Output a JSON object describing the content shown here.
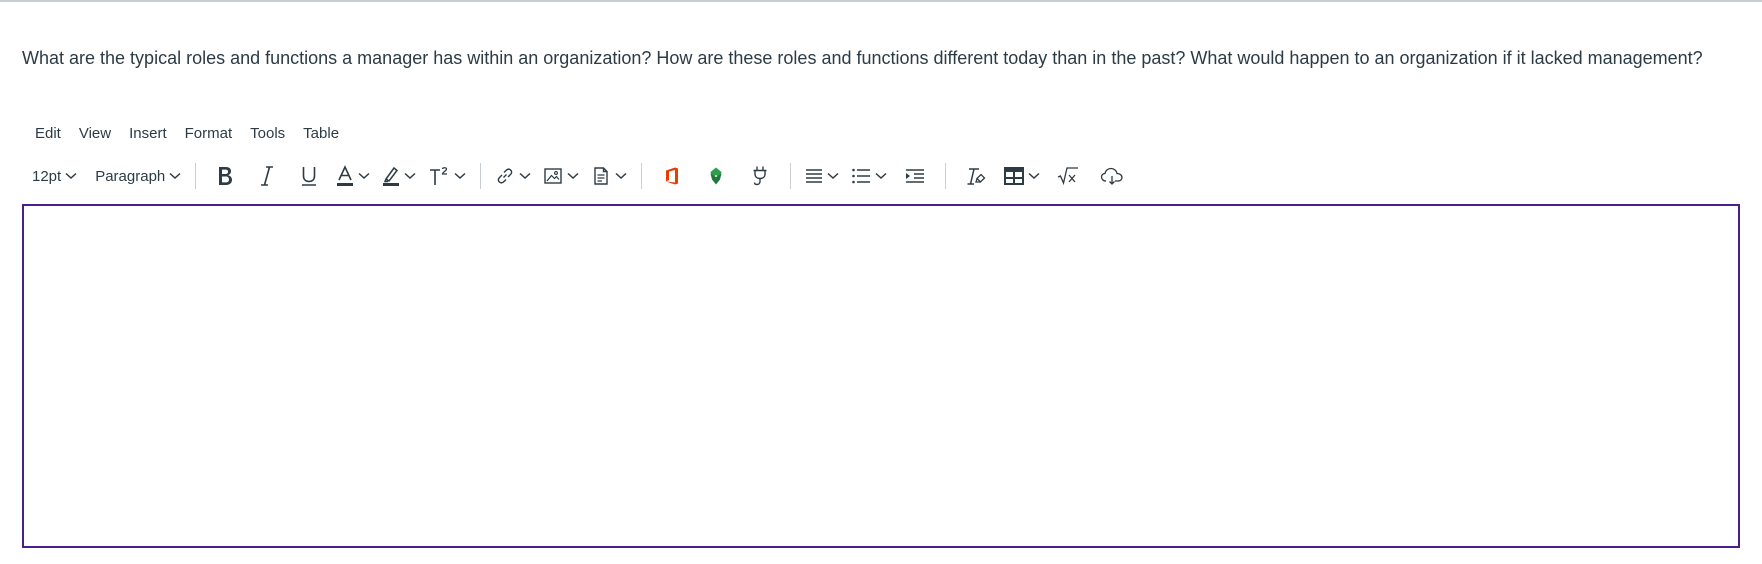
{
  "question": {
    "text": "What are the typical roles and functions a manager has within an organization? How are these roles and functions different today than in the past? What would happen to an organization if it lacked management?"
  },
  "menubar": {
    "items": [
      {
        "label": "Edit"
      },
      {
        "label": "View"
      },
      {
        "label": "Insert"
      },
      {
        "label": "Format"
      },
      {
        "label": "Tools"
      },
      {
        "label": "Table"
      }
    ]
  },
  "toolbar": {
    "font_size": "12pt",
    "block_format": "Paragraph",
    "icons": [
      "chevron-down-icon",
      "bold-icon",
      "italic-icon",
      "underline-icon",
      "text-color-icon",
      "highlight-icon",
      "superscript-icon",
      "link-icon",
      "image-icon",
      "document-icon",
      "office-icon",
      "recycle-icon",
      "plug-icon",
      "align-icon",
      "bullet-list-icon",
      "indent-icon",
      "clear-formatting-icon",
      "table-icon",
      "equation-icon",
      "cloud-icon"
    ]
  },
  "colors": {
    "text": "#2d3b45",
    "editor_border": "#4b1d8e",
    "office_orange": "#eb3c00",
    "recycle_green": "#2e9e4f"
  },
  "editor": {
    "content": ""
  }
}
